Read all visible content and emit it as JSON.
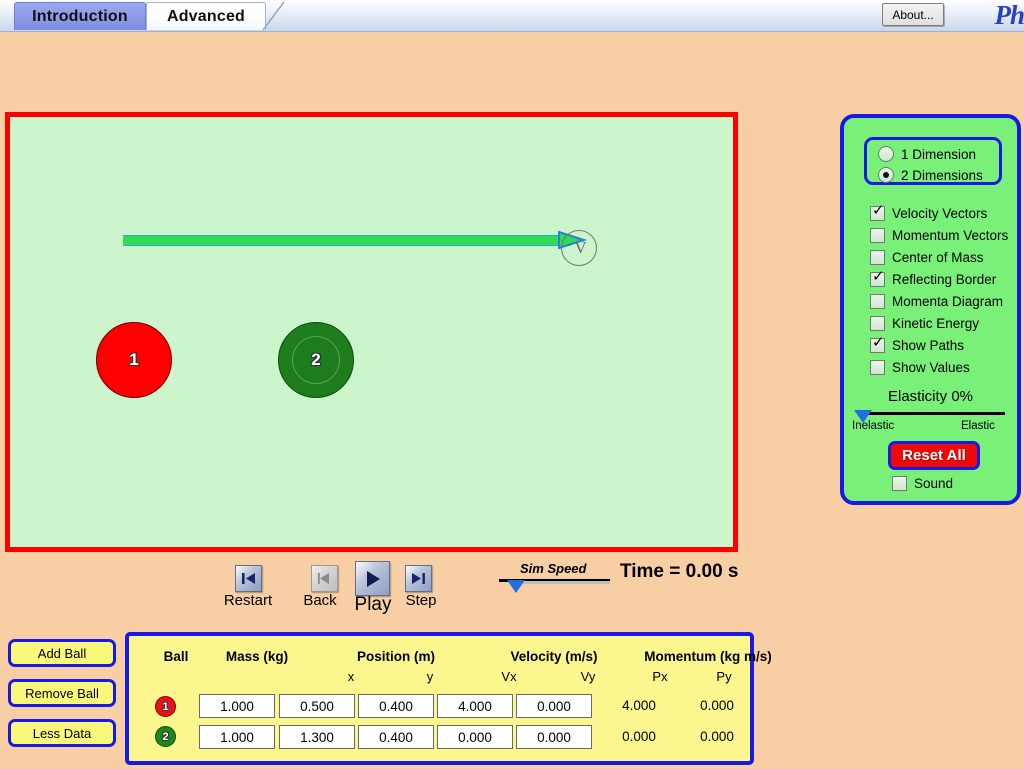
{
  "window": {
    "about_label": "About...",
    "logo_text": "Ph"
  },
  "tabs": [
    {
      "label": "Introduction",
      "active": false
    },
    {
      "label": "Advanced",
      "active": true
    }
  ],
  "field": {
    "balls": [
      {
        "number": "1",
        "color": "#ff0000",
        "label": "1"
      },
      {
        "number": "2",
        "color": "#1d7d1d",
        "label": "2"
      }
    ],
    "velocity_vector": {
      "letter": "V",
      "color": "#2fdd4f",
      "outline": "#2aa8e0"
    }
  },
  "playback": {
    "restart_label": "Restart",
    "back_label": "Back",
    "play_label": "Play",
    "step_label": "Step",
    "sim_speed_label": "Sim Speed",
    "time_label": "Time = 0.00 s"
  },
  "controls": {
    "dimension_options": [
      {
        "label": "1 Dimension",
        "selected": false
      },
      {
        "label": "2 Dimensions",
        "selected": true
      }
    ],
    "checkboxes": [
      {
        "label": "Velocity Vectors",
        "checked": true
      },
      {
        "label": "Momentum Vectors",
        "checked": false
      },
      {
        "label": "Center of Mass",
        "checked": false
      },
      {
        "label": "Reflecting Border",
        "checked": true
      },
      {
        "label": "Momenta Diagram",
        "checked": false
      },
      {
        "label": "Kinetic Energy",
        "checked": false
      },
      {
        "label": "Show Paths",
        "checked": true
      },
      {
        "label": "Show Values",
        "checked": false
      }
    ],
    "elasticity_title": "Elasticity 0%",
    "elasticity_value": 0,
    "elasticity_min_label": "Inelastic",
    "elasticity_max_label": "Elastic",
    "reset_all_label": "Reset All",
    "sound_label": "Sound",
    "sound_checked": false,
    "panel_color": "#79f179",
    "panel_border_color": "#1919e6"
  },
  "side_buttons": [
    {
      "label": "Add Ball"
    },
    {
      "label": "Remove Ball"
    },
    {
      "label": "Less Data"
    }
  ],
  "table": {
    "headers": {
      "ball": "Ball",
      "mass": "Mass (kg)",
      "position": "Position (m)",
      "velocity": "Velocity (m/s)",
      "momentum": "Momentum (kg m/s)"
    },
    "subheaders": {
      "px": "x",
      "py": "y",
      "vx": "Vx",
      "vy": "Vy",
      "mx": "Px",
      "my": "Py"
    },
    "rows": [
      {
        "badge": "1",
        "badge_color": "#e8131a",
        "mass": "1.000",
        "x": "0.500",
        "y": "0.400",
        "vx": "4.000",
        "vy": "0.000",
        "px": "4.000",
        "py": "0.000"
      },
      {
        "badge": "2",
        "badge_color": "#1b8a1b",
        "mass": "1.000",
        "x": "1.300",
        "y": "0.400",
        "vx": "0.000",
        "vy": "0.000",
        "px": "0.000",
        "py": "0.000"
      }
    ]
  }
}
